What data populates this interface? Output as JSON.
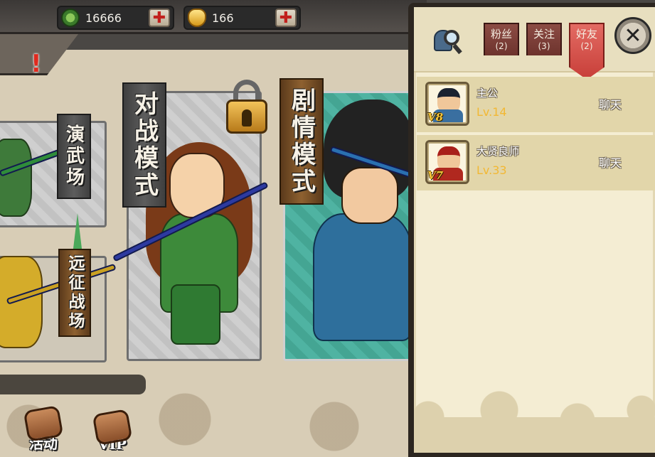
{
  "currency": {
    "jade_amount": "16666",
    "gold_amount": "166"
  },
  "alert": {
    "mark": "!"
  },
  "modes": {
    "yanwu": "演武场",
    "yuanzheng": "远征战场",
    "duizhan": "对战模式",
    "juqing": "剧情模式"
  },
  "bottom_buttons": {
    "huodong": "活动",
    "vip": "VIP"
  },
  "panel": {
    "tabs": [
      {
        "label": "粉丝",
        "count": "(2)"
      },
      {
        "label": "关注",
        "count": "(3)"
      },
      {
        "label": "好友",
        "count": "(2)"
      }
    ],
    "active_tab": "好友",
    "close_symbol": "✕",
    "friends": [
      {
        "name": "主公",
        "level": "Lv.14",
        "vip": "V8",
        "action": "聊天"
      },
      {
        "name": "大贤良师",
        "level": "Lv.33",
        "vip": "V7",
        "action": "聊天"
      }
    ]
  },
  "icons": {
    "jade": "jade-coin-icon",
    "gold": "gold-ingot-icon",
    "plus": "plus-icon",
    "lock": "lock-icon",
    "search": "search-friend-icon",
    "close": "close-icon"
  },
  "colors": {
    "plus_red": "#c1201d",
    "active_tab": "#e36b63",
    "level_gold": "#f2b834",
    "panel_bg": "#f4edd3"
  }
}
